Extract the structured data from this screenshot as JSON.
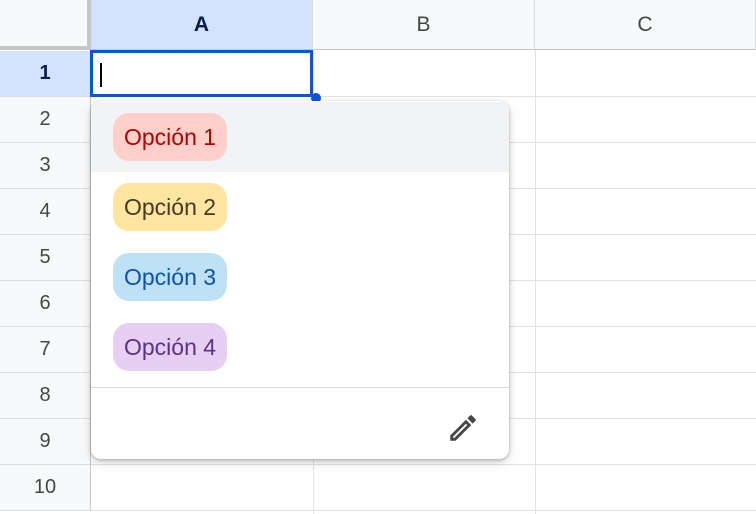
{
  "columns": [
    {
      "label": "A",
      "active": true
    },
    {
      "label": "B",
      "active": false
    },
    {
      "label": "C",
      "active": false
    }
  ],
  "rows": [
    "1",
    "2",
    "3",
    "4",
    "5",
    "6",
    "7",
    "8",
    "9",
    "10"
  ],
  "active_row": "1",
  "active_cell": {
    "ref": "A1",
    "value": ""
  },
  "dropdown": {
    "options": [
      {
        "label": "Opción 1",
        "bg": "#ffcfc9",
        "fg": "#b10202",
        "hovered": true
      },
      {
        "label": "Opción 2",
        "bg": "#ffe5a0",
        "fg": "#473821",
        "hovered": false
      },
      {
        "label": "Opción 3",
        "bg": "#bfe1f6",
        "fg": "#0a53a8",
        "hovered": false
      },
      {
        "label": "Opción 4",
        "bg": "#e6cff2",
        "fg": "#5a3286",
        "hovered": false
      }
    ],
    "edit_icon": "pencil-icon"
  },
  "colors": {
    "accent": "#0b57d0",
    "header_active_bg": "#d3e3fd",
    "header_bg": "#f8f9fa"
  }
}
